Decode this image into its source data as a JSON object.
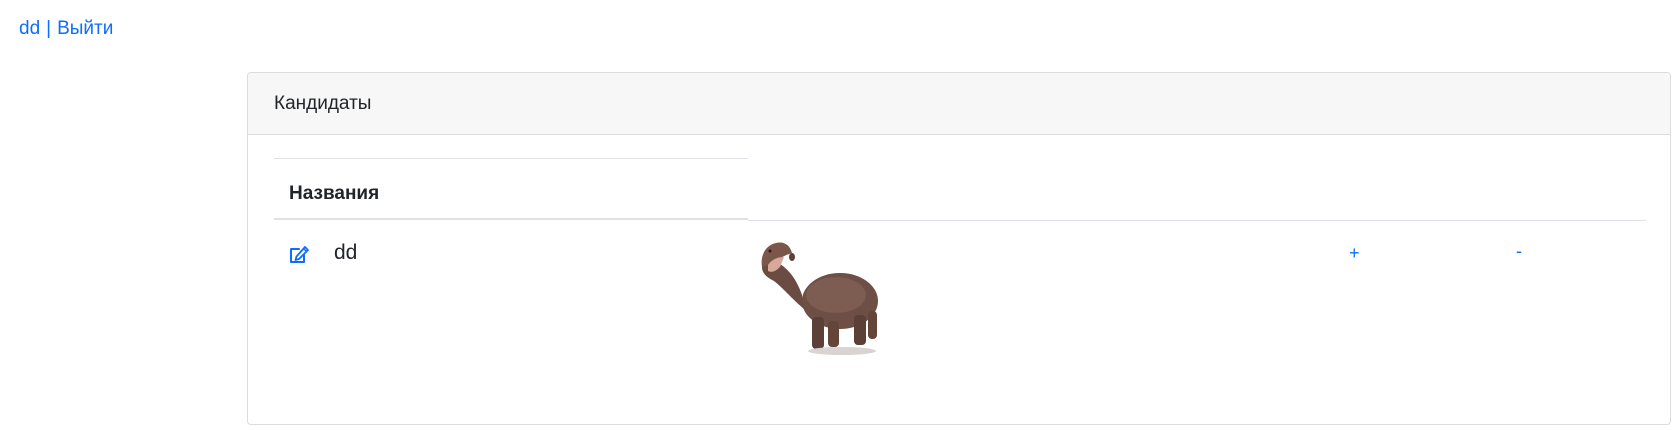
{
  "nav": {
    "user": "dd",
    "separator": "|",
    "logout": "Выйти"
  },
  "card": {
    "title": "Кандидаты",
    "table": {
      "header": "Названия",
      "rows": [
        {
          "icon": "edit-icon",
          "name": "dd",
          "image": "hippo-photo",
          "plus": "+",
          "minus": "-"
        }
      ]
    }
  },
  "colors": {
    "link": "#0d6efd",
    "header_bg": "#f7f7f7",
    "border": "#dcdcdc"
  }
}
